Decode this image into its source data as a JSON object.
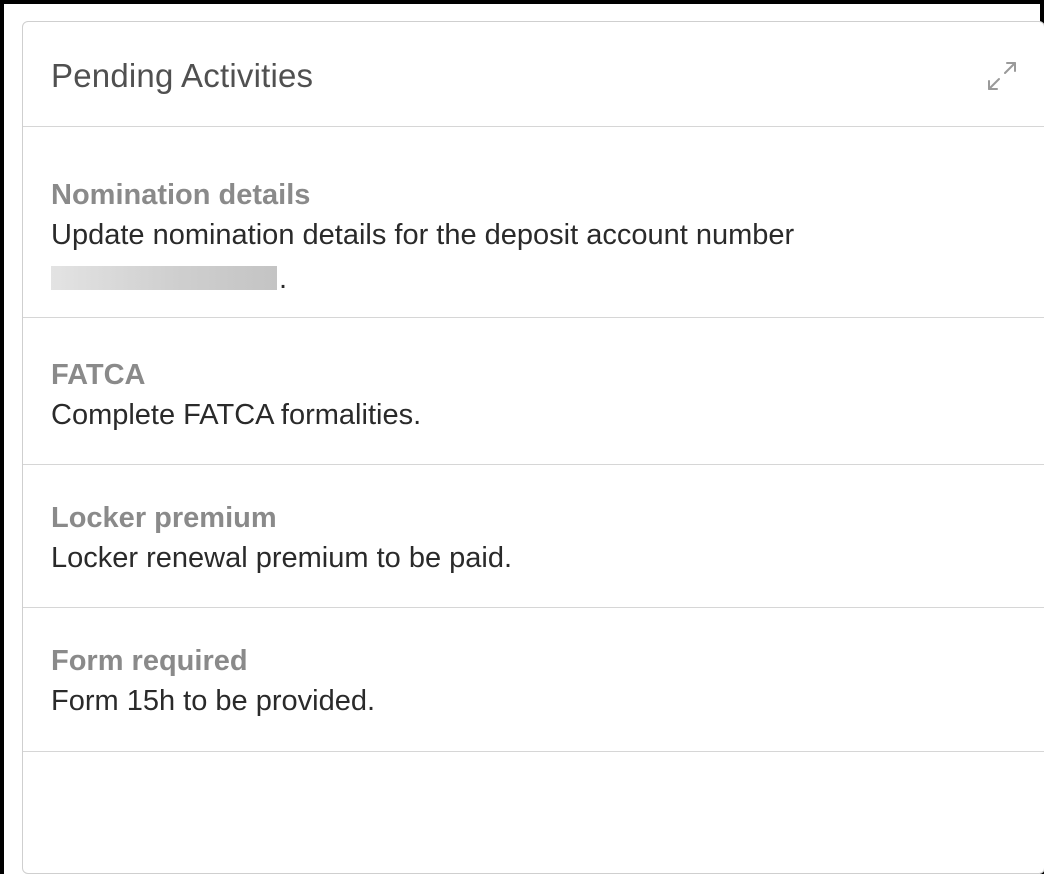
{
  "card": {
    "title": "Pending Activities",
    "expand_icon": "expand-icon"
  },
  "activities": [
    {
      "title": "Nomination details",
      "description": "Update nomination details for the deposit account number",
      "description_suffix": "."
    },
    {
      "title": "FATCA",
      "description": "Complete FATCA formalities."
    },
    {
      "title": "Locker premium",
      "description": "Locker renewal premium to be paid."
    },
    {
      "title": "Form required",
      "description": "Form 15h to be provided."
    }
  ],
  "colors": {
    "title_text": "#505050",
    "item_title_text": "#8a8a8a",
    "item_desc_text": "#2a2a2a",
    "divider": "#d6d6d6"
  }
}
